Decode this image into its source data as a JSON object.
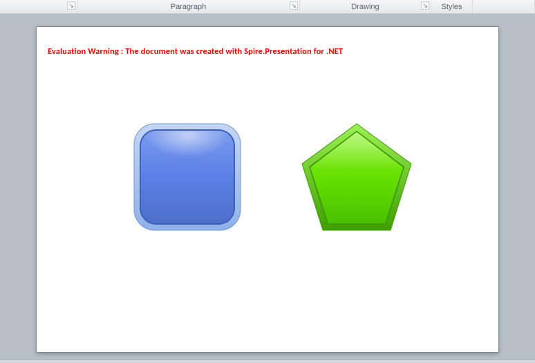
{
  "ribbon": {
    "group_paragraph": "Paragraph",
    "group_drawing": "Drawing",
    "group_styles": "Styles"
  },
  "slide": {
    "warning": "Evaluation Warning : The document was created with  Spire.Presentation for .NET"
  },
  "shapes": {
    "rounded_square": {
      "fill_main": "#5a7fe6",
      "fill_light": "#7a9bee",
      "rim": "#a6c1ef",
      "rim_dark": "#4e6fca"
    },
    "pentagon": {
      "fill_main": "#66e000",
      "fill_light": "#8cf22a",
      "rim": "#4bbf00",
      "rim_dark": "#3e9e00"
    }
  }
}
